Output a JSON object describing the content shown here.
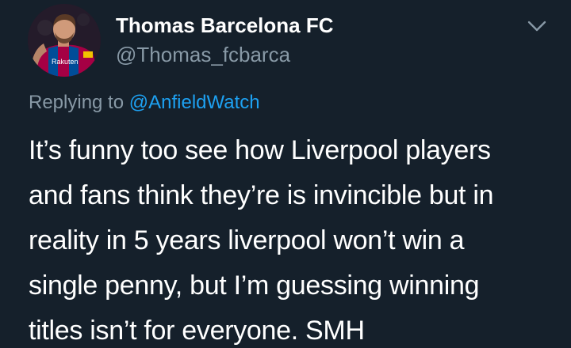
{
  "header": {
    "display_name": "Thomas Barcelona FC",
    "handle": "@Thomas_fcbarca",
    "avatar_icon": "user-avatar-football-player",
    "menu_icon": "chevron-down-icon"
  },
  "reply": {
    "prefix": "Replying to",
    "mention": "@AnfieldWatch"
  },
  "tweet": {
    "lines": [
      "It’s funny too see how Liverpool players",
      "and fans think they’re is invincible but in",
      "reality in 5 years liverpool won’t win a",
      "single penny, but I’m guessing winning",
      "titles isn’t for everyone. SMH"
    ]
  },
  "colors": {
    "background": "#15202b",
    "primary_text": "#ffffff",
    "secondary_text": "#8899a6",
    "link": "#1da1f2"
  }
}
